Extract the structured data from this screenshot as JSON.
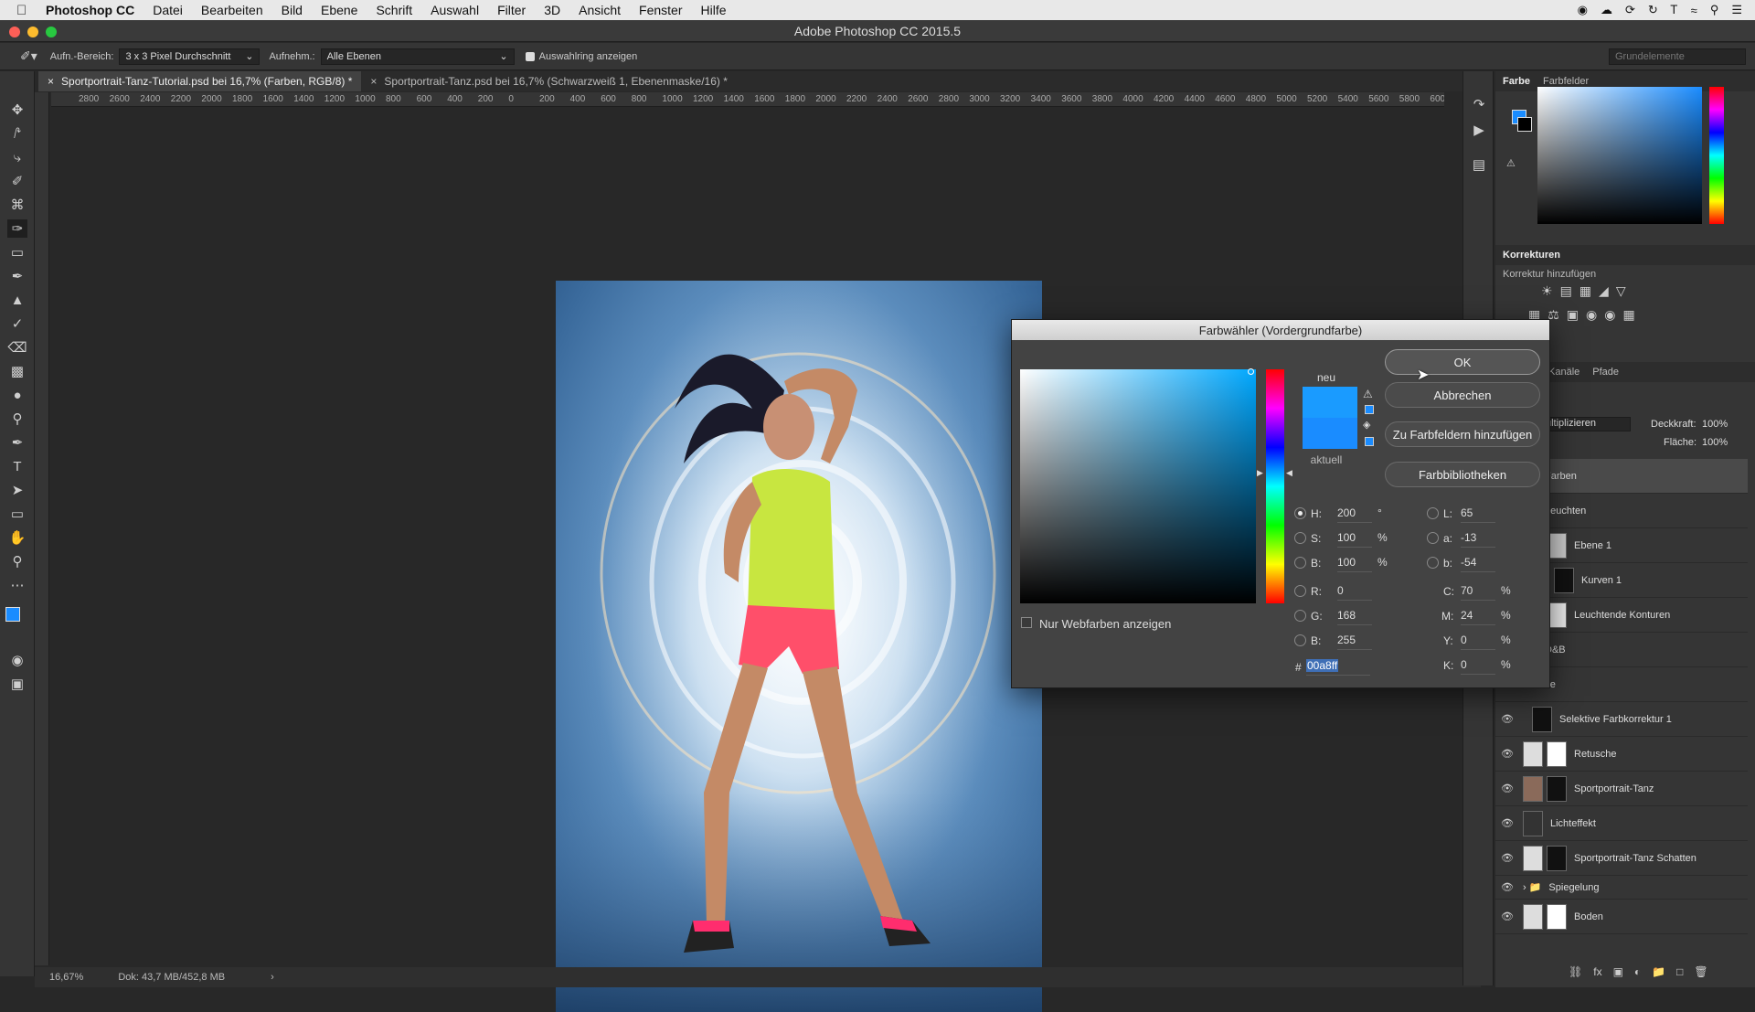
{
  "menubar": {
    "app": "Photoshop CC",
    "items": [
      "Datei",
      "Bearbeiten",
      "Bild",
      "Ebene",
      "Schrift",
      "Auswahl",
      "Filter",
      "3D",
      "Ansicht",
      "Fenster",
      "Hilfe"
    ]
  },
  "window": {
    "title": "Adobe Photoshop CC 2015.5"
  },
  "options": {
    "sample_area_label": "Aufn.-Bereich:",
    "sample_area_value": "3 x 3 Pixel Durchschnitt",
    "sample_label": "Aufnehm.:",
    "sample_value": "Alle Ebenen",
    "show_ring_label": "Auswahlring anzeigen",
    "workspace": "Grundelemente"
  },
  "tabs": [
    {
      "label": "Sportportrait-Tanz-Tutorial.psd bei 16,7% (Farben, RGB/8) *"
    },
    {
      "label": "Sportportrait-Tanz.psd bei 16,7% (Schwarzweiß 1, Ebenenmaske/16) *"
    }
  ],
  "ruler": [
    "2800",
    "2600",
    "2400",
    "2200",
    "2000",
    "1800",
    "1600",
    "1400",
    "1200",
    "1000",
    "800",
    "600",
    "400",
    "200",
    "0",
    "200",
    "400",
    "600",
    "800",
    "1000",
    "1200",
    "1400",
    "1600",
    "1800",
    "2000",
    "2200",
    "2400",
    "2600",
    "2800",
    "3000",
    "3200",
    "3400",
    "3600",
    "3800",
    "4000",
    "4200",
    "4400",
    "4600",
    "4800",
    "5000",
    "5200",
    "5400",
    "5600",
    "5800",
    "6000"
  ],
  "status": {
    "zoom": "16,67%",
    "doc": "Dok: 43,7 MB/452,8 MB"
  },
  "color_panel": {
    "tab1": "Farbe",
    "tab2": "Farbfelder"
  },
  "adjustments": {
    "title": "Korrekturen",
    "subtitle": "Korrektur hinzufügen"
  },
  "layers_panel": {
    "tab1": "Kanäle",
    "tab2": "Pfade",
    "blend_mode": "ultiplizieren",
    "opacity_label": "Deckkraft:",
    "opacity": "100%",
    "fill_label": "Fläche:",
    "fill": "100%",
    "layers": [
      "Farben",
      "Leuchten",
      "Ebene 1",
      "Kurven 1",
      "Leuchtende Konturen",
      "D&B",
      "Schärfe",
      "Selektive Farbkorrektur 1",
      "Retusche",
      "Sportportrait-Tanz",
      "Lichteffekt",
      "Sportportrait-Tanz Schatten",
      "Spiegelung",
      "Boden"
    ]
  },
  "dialog": {
    "title": "Farbwähler (Vordergrundfarbe)",
    "new_label": "neu",
    "current_label": "aktuell",
    "new_color": "#1a9bff",
    "current_color": "#1a8cff",
    "ok": "OK",
    "cancel": "Abbrechen",
    "add_swatch": "Zu Farbfeldern hinzufügen",
    "libraries": "Farbbibliotheken",
    "web_only": "Nur Webfarben anzeigen",
    "H": "200",
    "S": "100",
    "Bv": "100",
    "R": "0",
    "G": "168",
    "Bc": "255",
    "L": "65",
    "a": "-13",
    "b": "-54",
    "C": "70",
    "M": "24",
    "Y": "0",
    "K": "0",
    "hex": "00a8ff",
    "deg": "°",
    "pct": "%"
  }
}
